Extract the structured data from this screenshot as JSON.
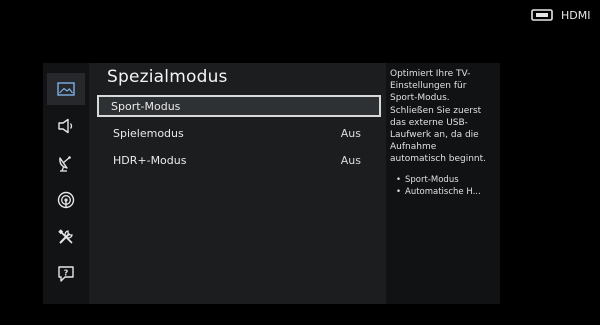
{
  "source": {
    "label": "HDMI",
    "icon": "hdmi-port-icon"
  },
  "sidebar": {
    "items": [
      {
        "icon": "picture-icon",
        "active": true
      },
      {
        "icon": "speaker-icon",
        "active": false
      },
      {
        "icon": "satellite-dish-icon",
        "active": false
      },
      {
        "icon": "network-icon",
        "active": false
      },
      {
        "icon": "tools-icon",
        "active": false
      },
      {
        "icon": "support-icon",
        "active": false
      }
    ]
  },
  "menu": {
    "title": "Spezialmodus",
    "items": [
      {
        "label": "Sport-Modus",
        "value": "",
        "selected": true
      },
      {
        "label": "Spielemodus",
        "value": "Aus",
        "selected": false
      },
      {
        "label": "HDR+-Modus",
        "value": "Aus",
        "selected": false
      }
    ]
  },
  "help": {
    "lines": [
      "Optimiert Ihre TV-",
      "Einstellungen für",
      "Sport-Modus.",
      "Schließen Sie zuerst",
      "das externe USB-",
      "Laufwerk an, da die",
      "Aufnahme",
      "automatisch beginnt."
    ],
    "bullets": [
      "Sport-Modus",
      "Automatische H..."
    ]
  },
  "colors": {
    "background": "#000000",
    "panel": "#1b1d1f",
    "iconbar": "#121314",
    "helppanel": "#111213",
    "selection_border": "#d9d9d9"
  }
}
